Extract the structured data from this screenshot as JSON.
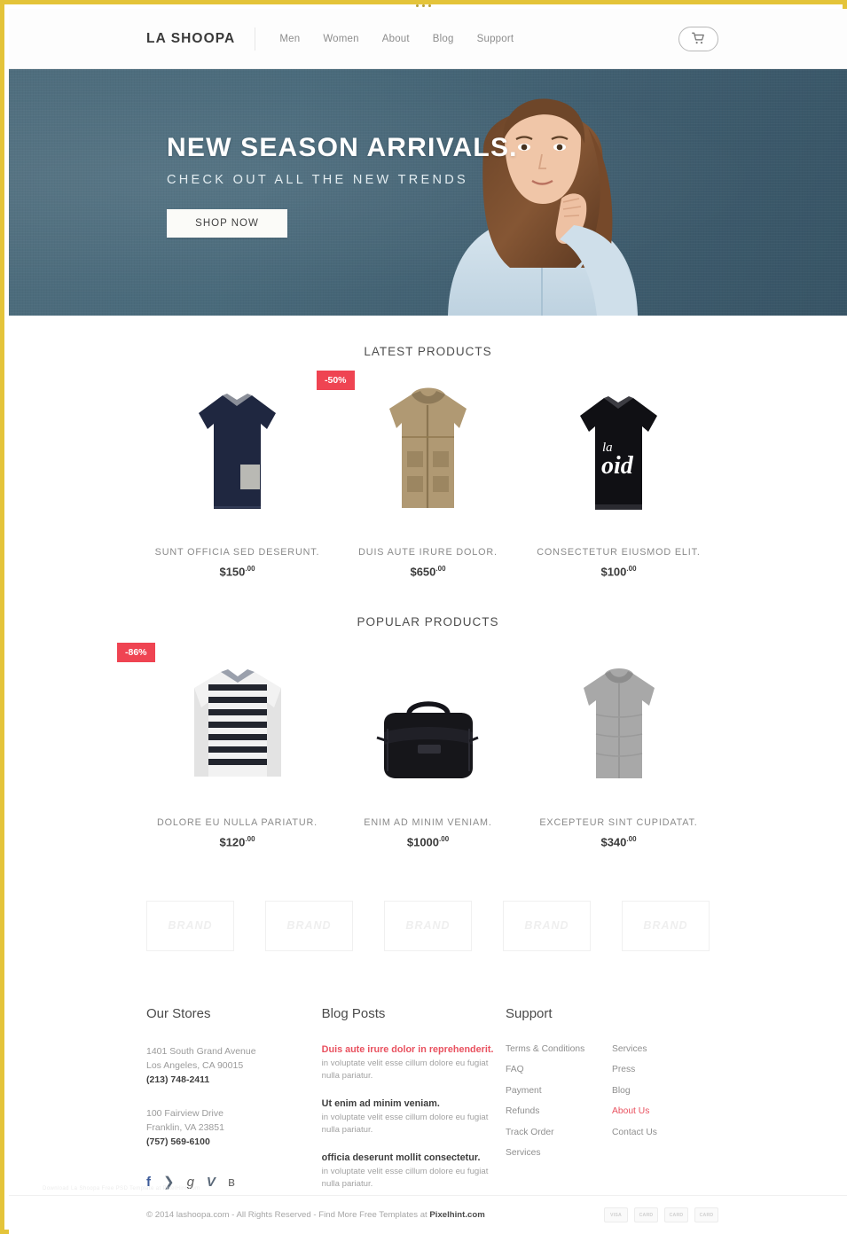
{
  "window": {
    "frame_color": "#e4c43a",
    "dots": 3
  },
  "header": {
    "logo": "LA SHOOPA",
    "nav": [
      {
        "label": "Men"
      },
      {
        "label": "Women"
      },
      {
        "label": "About"
      },
      {
        "label": "Blog"
      },
      {
        "label": "Support"
      }
    ],
    "cart_icon": "shopping-cart-icon"
  },
  "hero": {
    "title": "NEW SEASON ARRIVALS.",
    "subtitle": "CHECK OUT ALL THE NEW TRENDS",
    "cta": "SHOP NOW",
    "bg_color": "#456578"
  },
  "latest": {
    "heading": "LATEST PRODUCTS",
    "products": [
      {
        "name": "SUNT OFFICIA SED DESERUNT.",
        "price": "$150",
        "cents": ".00",
        "badge": null,
        "image": "navy-sweater"
      },
      {
        "name": "DUIS AUTE IRURE DOLOR.",
        "price": "$650",
        "cents": ".00",
        "badge": "-50%",
        "image": "beige-parka-jacket"
      },
      {
        "name": "CONSECTETUR EIUSMOD ELIT.",
        "price": "$100",
        "cents": ".00",
        "badge": null,
        "image": "black-void-sweatshirt"
      }
    ]
  },
  "popular": {
    "heading": "POPULAR PRODUCTS",
    "products": [
      {
        "name": "DOLORE EU NULLA PARIATUR.",
        "price": "$120",
        "cents": ".00",
        "badge": "-86%",
        "image": "striped-longsleeve-top"
      },
      {
        "name": "ENIM AD MINIM VENIAM.",
        "price": "$1000",
        "cents": ".00",
        "badge": null,
        "image": "black-leather-duffel-bag"
      },
      {
        "name": "EXCEPTEUR SINT CUPIDATAT.",
        "price": "$340",
        "cents": ".00",
        "badge": null,
        "image": "grey-knit-cardigan"
      }
    ]
  },
  "brands": [
    {
      "label": "BRAND"
    },
    {
      "label": "BRAND"
    },
    {
      "label": "BRAND"
    },
    {
      "label": "BRAND"
    },
    {
      "label": "BRAND"
    }
  ],
  "footer": {
    "stores": {
      "heading": "Our Stores",
      "locations": [
        {
          "street": "1401 South Grand Avenue",
          "city": "Los Angeles, CA 90015",
          "phone": "(213) 748-2411"
        },
        {
          "street": "100 Fairview Drive",
          "city": "Franklin, VA 23851",
          "phone": "(757) 569-6100"
        }
      ],
      "social": [
        {
          "icon": "facebook-icon",
          "glyph": "f"
        },
        {
          "icon": "twitter-icon",
          "glyph": "❯"
        },
        {
          "icon": "google-plus-icon",
          "glyph": "g"
        },
        {
          "icon": "vimeo-icon",
          "glyph": "V"
        },
        {
          "icon": "rss-icon",
          "glyph": "ʙ"
        }
      ]
    },
    "blog": {
      "heading": "Blog Posts",
      "posts": [
        {
          "title": "Duis aute irure dolor in reprehenderit.",
          "text": "in voluptate velit esse cillum dolore eu fugiat nulla pariatur.",
          "highlight": true
        },
        {
          "title": "Ut enim ad minim veniam.",
          "text": "in voluptate velit esse cillum dolore eu fugiat nulla pariatur.",
          "highlight": false
        },
        {
          "title": "officia deserunt mollit consectetur.",
          "text": "in voluptate velit esse cillum dolore eu fugiat nulla pariatur.",
          "highlight": false
        }
      ]
    },
    "support": {
      "heading": "Support",
      "column_left": [
        {
          "label": "Terms & Conditions",
          "highlight": false
        },
        {
          "label": "FAQ",
          "highlight": false
        },
        {
          "label": "Payment",
          "highlight": false
        },
        {
          "label": "Refunds",
          "highlight": false
        },
        {
          "label": "Track Order",
          "highlight": false
        },
        {
          "label": "Services",
          "highlight": false
        }
      ],
      "column_right": [
        {
          "label": "Services",
          "highlight": false
        },
        {
          "label": "Press",
          "highlight": false
        },
        {
          "label": "Blog",
          "highlight": false
        },
        {
          "label": "About Us",
          "highlight": true
        },
        {
          "label": "Contact Us",
          "highlight": false
        }
      ]
    }
  },
  "bottom": {
    "copyright_pre": "© 2014 lashoopa.com  -  All Rights Reserved  -  Find More Free Templates at ",
    "copyright_link": "Pixelhint.com",
    "payments": [
      {
        "label": "VISA"
      },
      {
        "label": "CARD"
      },
      {
        "label": "CARD"
      },
      {
        "label": "CARD"
      }
    ],
    "watermark": "Download  La Shoopa Free PSD Template at PixelHint.com"
  },
  "colors": {
    "accent_red": "#ef4452",
    "link_red": "#e9515f",
    "hero": "#456578",
    "text": "#4a4a4a"
  }
}
